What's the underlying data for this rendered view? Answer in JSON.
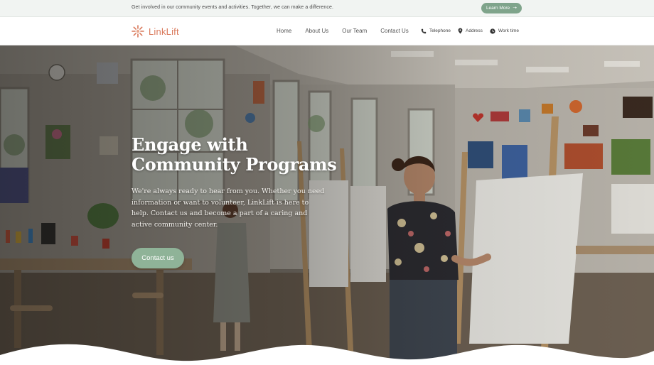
{
  "topbar": {
    "announcement": "Get involved in our community events and activities. Together, we can make a difference.",
    "learn_more_label": "Learn More",
    "learn_more_icon": "arrow-right-icon",
    "background": "#f1f4f2",
    "button_color": "#7fa48b"
  },
  "header": {
    "logo_text": "LinkLift",
    "logo_color": "#d9785a",
    "nav": [
      {
        "label": "Home"
      },
      {
        "label": "About Us"
      },
      {
        "label": "Our Team"
      },
      {
        "label": "Contact Us"
      }
    ],
    "contact": [
      {
        "label": "Telephone",
        "icon": "phone-icon"
      },
      {
        "label": "Address",
        "icon": "location-pin-icon"
      },
      {
        "label": "Work time",
        "icon": "clock-icon"
      }
    ]
  },
  "hero": {
    "title_line1": "Engage with",
    "title_line2": "Community Programs",
    "text": "We're always ready to hear from you. Whether you need information or want to volunteer, LinkLift is here to help. Contact us and become a part of a caring and active community center.",
    "cta_label": "Contact us",
    "cta_color": "#8fb398",
    "image": "art-studio-photo"
  }
}
